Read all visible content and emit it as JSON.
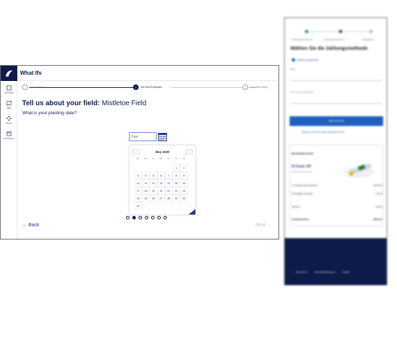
{
  "app": {
    "title": "What Ifs",
    "rail": [
      {
        "icon": "fields-icon",
        "label": "My Fields"
      },
      {
        "icon": "map-icon",
        "label": "Map"
      },
      {
        "icon": "moves-icon",
        "label": "Moves"
      },
      {
        "icon": "planner-icon",
        "label": "My Planner"
      }
    ],
    "steps": [
      {
        "label": "Choose Field",
        "state": "done"
      },
      {
        "label": "Set Field Properties",
        "state": "active"
      },
      {
        "label": "Complete Setup",
        "state": "todo"
      }
    ],
    "heading_bold": "Tell us about your field:",
    "heading_name": "Mistletoe Field",
    "question": "What is your planting date?",
    "date_placeholder": "Date",
    "calendar": {
      "month": "May 2020",
      "prev": "←",
      "next": "→",
      "weekdays": [
        "Su",
        "Mo",
        "Tu",
        "We",
        "Th",
        "Fr",
        "Sa"
      ],
      "days": [
        "",
        "",
        "",
        "",
        "",
        "1",
        "2",
        "3",
        "4",
        "5",
        "6",
        "7",
        "8",
        "9",
        "10",
        "11",
        "12",
        "13",
        "14",
        "15",
        "16",
        "17",
        "18",
        "19",
        "20",
        "21",
        "22",
        "23",
        "24",
        "25",
        "26",
        "27",
        "28",
        "29",
        "30",
        "31"
      ]
    },
    "pager": {
      "count": 7,
      "active_index": 1
    },
    "back_label": "← Back",
    "next_label": "Next →",
    "colors": {
      "navy": "#0d1b4b",
      "accent": "#1f3a8a",
      "disabled": "#b8c0d6"
    }
  },
  "side": {
    "steps": [
      "Zahlungsinformationen",
      "Zahlungsinformationen",
      "Bestätigung"
    ],
    "title": "Wählen Sie die Zahlungsmethode",
    "radio_label": "SEPA-Lastschrift",
    "fields": [
      "IBAN",
      "Name des Kontoinhabers"
    ],
    "button": "WEITER ZUR",
    "link": "Zahlung mit dem Lastschriftmandat bitte",
    "summary_title": "Bestellübersicht",
    "product": "N-Tester XP",
    "product_sub": "Produkt Ratenzahlung",
    "rows": [
      {
        "label": "1x Monats-Abonnement",
        "value": "299,00 €"
      },
      {
        "label": "Einmaliger Versand",
        "value": "0,00 €"
      },
      {
        "label": "Steuern",
        "value": "0,00 €"
      }
    ],
    "total": {
      "label": "Gesamtsumme",
      "value": "299,00 €"
    },
    "footer_links": [
      "Datenschutz",
      "Nutzungsbedingungen",
      "Kontakt"
    ]
  }
}
